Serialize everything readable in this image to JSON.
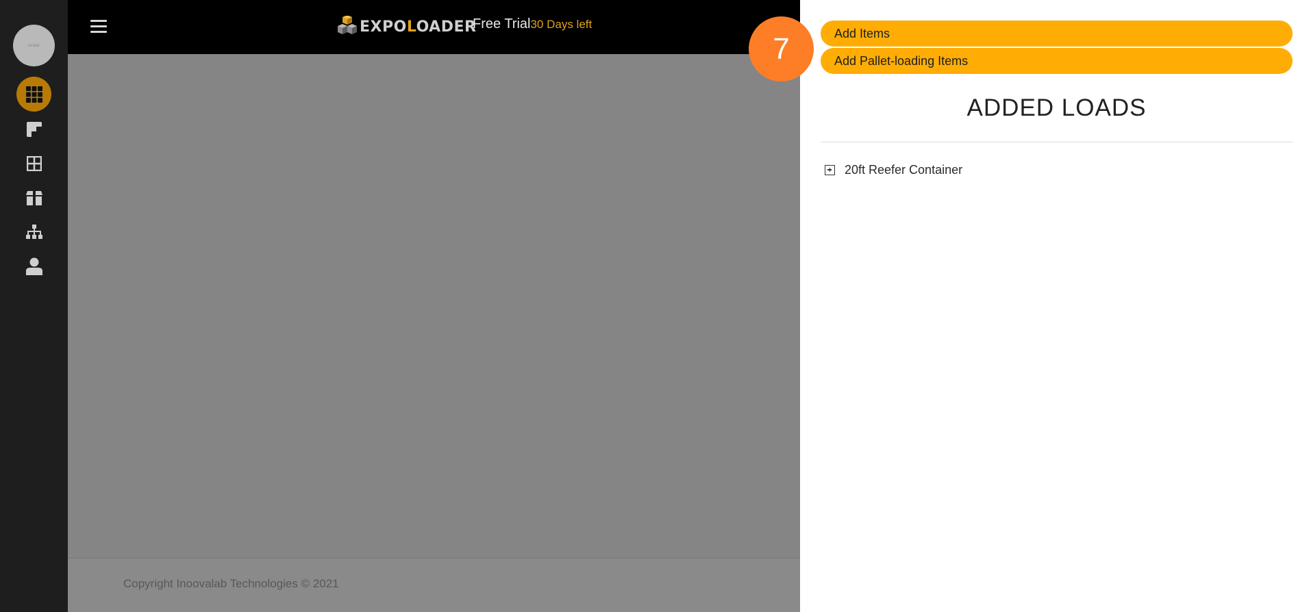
{
  "sidebar": {
    "avatar_text": "avatar",
    "items": [
      {
        "name": "dashboard",
        "icon": "grid-icon",
        "active": true
      },
      {
        "name": "containers",
        "icon": "flipboard-icon",
        "active": false
      },
      {
        "name": "layouts",
        "icon": "windows-icon",
        "active": false
      },
      {
        "name": "boxes",
        "icon": "box-icon",
        "active": false
      },
      {
        "name": "organization",
        "icon": "sitemap-icon",
        "active": false
      },
      {
        "name": "profile",
        "icon": "user-icon",
        "active": false
      }
    ]
  },
  "header": {
    "logo": {
      "prefix": "EXPO",
      "accent": "L",
      "suffix": "OADER"
    },
    "trial_label": "Free Trial",
    "days_left": "30 Days left"
  },
  "footer": {
    "copyright": "Copyright Inoovalab Technologies © 2021"
  },
  "panel": {
    "add_items_label": "Add Items",
    "add_pallet_label": "Add Pallet-loading Items",
    "title": "ADDED LOADS",
    "loads": [
      {
        "label": "20ft Reefer Container"
      }
    ]
  },
  "step_badge": "7",
  "colors": {
    "accent_orange": "#ffad05",
    "active_nav": "#b87a05",
    "step_badge": "#fd7e26",
    "logo_accent": "#e2a21c"
  }
}
